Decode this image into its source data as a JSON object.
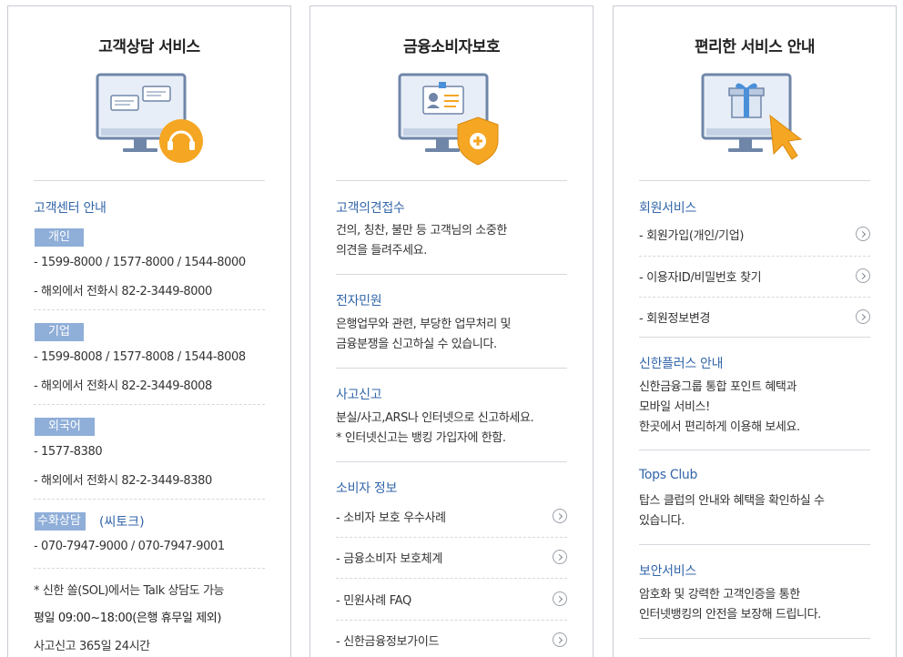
{
  "customer": {
    "title": "고객상담 서비스",
    "section_title": "고객센터 안내",
    "groups": [
      {
        "badge": "개인",
        "lines": [
          "-  1599-8000 / 1577-8000 / 1544-8000",
          "-  해외에서 전화시 82-2-3449-8000"
        ]
      },
      {
        "badge": "기업",
        "lines": [
          "-  1599-8008 / 1577-8008 / 1544-8008",
          "-  해외에서 전화시 82-2-3449-8008"
        ]
      },
      {
        "badge": "외국어",
        "lines": [
          "-  1577-8380",
          "-  해외에서 전화시 82-2-3449-8380"
        ]
      },
      {
        "badge": "수화상담",
        "link": "(씨토크)",
        "lines": [
          "-  070-7947-9000 / 070-7947-9001"
        ]
      }
    ],
    "notes": [
      "* 신한 쏠(SOL)에서는 Talk 상담도 가능",
      "평일 09:00~18:00(은행 휴무일 제외)",
      "사고신고 365일 24시간"
    ]
  },
  "protection": {
    "title": "금융소비자보호",
    "sections": [
      {
        "title": "고객의견접수",
        "desc": [
          "건의, 칭찬, 불만 등 고객님의 소중한",
          "의견을 들려주세요."
        ]
      },
      {
        "title": "전자민원",
        "desc": [
          "은행업무와 관련, 부당한 업무처리 및",
          "금융분쟁을 신고하실 수 있습니다."
        ]
      },
      {
        "title": "사고신고",
        "desc": [
          "분실/사고,ARS나 인터넷으로 신고하세요.",
          "* 인터넷신고는 뱅킹 가입자에 한함."
        ]
      }
    ],
    "info_title": "소비자 정보",
    "links": [
      "-  소비자 보호 우수사례",
      "-  금융소비자 보호체계",
      "-  민원사례 FAQ",
      "-  신한금융정보가이드"
    ]
  },
  "convenience": {
    "title": "편리한 서비스 안내",
    "member_title": "회원서비스",
    "member_links": [
      "-  회원가입(개인/기업)",
      "-  이용자ID/비밀번호 찾기",
      "-  회원정보변경"
    ],
    "sections": [
      {
        "title": "신한플러스 안내",
        "desc": [
          "신한금융그룹 통합 포인트 혜택과",
          "모바일 서비스!",
          "한곳에서 편리하게 이용해 보세요."
        ]
      },
      {
        "title": "Tops Club",
        "desc": [
          "탑스 클럽의 안내와 혜택을 확인하실 수",
          "있습니다."
        ]
      },
      {
        "title": "보안서비스",
        "desc": [
          "암호화 및 강력한 고객인증을 통한",
          "인터넷뱅킹의 안전을 보장해 드립니다."
        ]
      }
    ]
  },
  "colors": {
    "accent_blue": "#3366aa",
    "badge_bg": "#8faed8",
    "orange": "#f5a623",
    "monitor": "#6f86a8"
  }
}
